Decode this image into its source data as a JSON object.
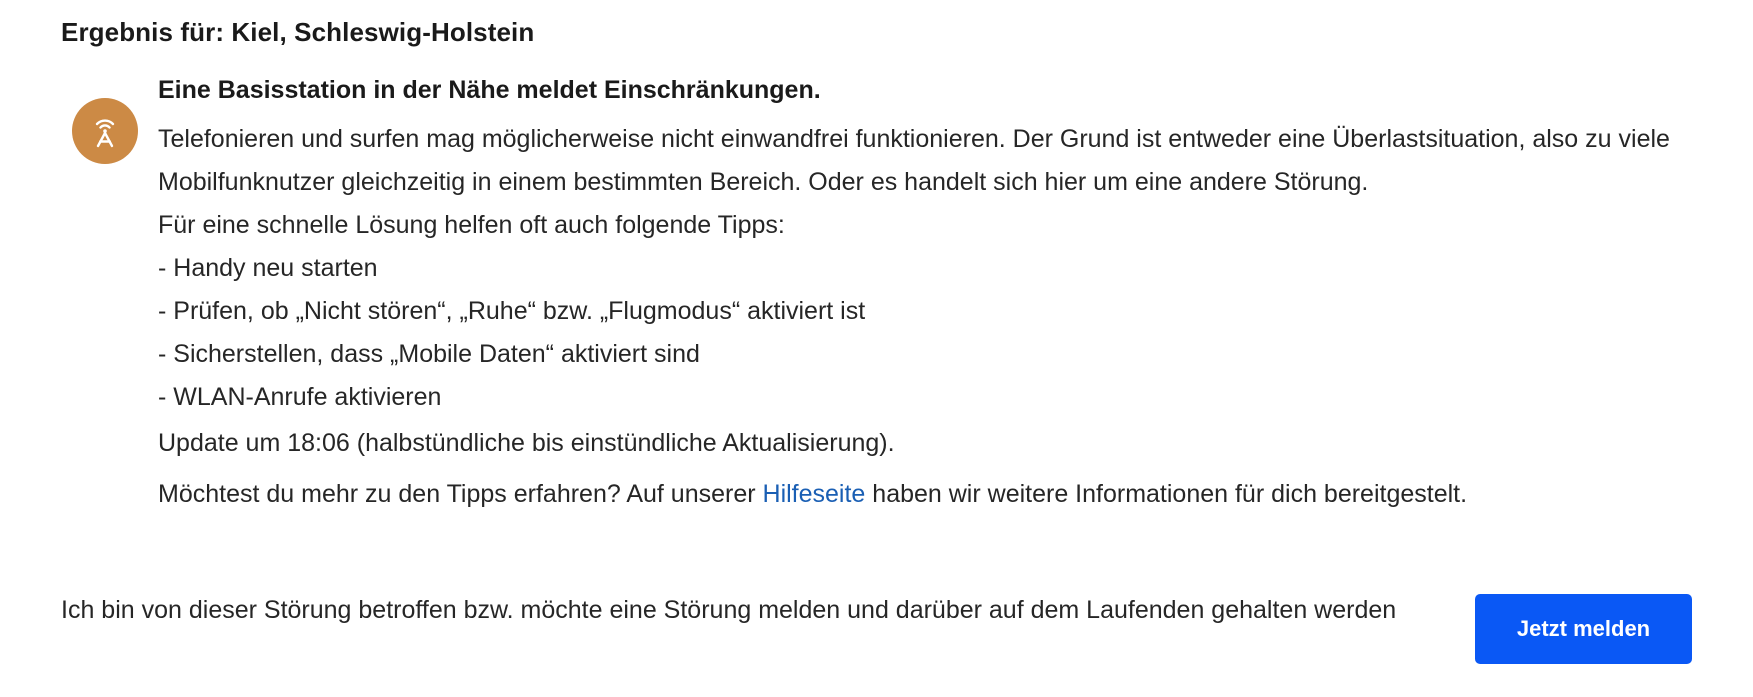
{
  "result": {
    "title": "Ergebnis für: Kiel, Schleswig-Holstein"
  },
  "status": {
    "icon": "cell-tower-icon",
    "icon_color": "#cc8a45",
    "headline": "Eine Basisstation in der Nähe meldet Einschränkungen.",
    "description": "Telefonieren und surfen mag möglicherweise nicht einwandfrei funktionieren. Der Grund ist entweder eine Überlastsituation, also zu viele Mobilfunknutzer gleichzeitig in einem bestimmten Bereich. Oder es handelt sich hier um eine andere Störung.",
    "tips_intro": "Für eine schnelle Lösung helfen oft auch folgende Tipps:",
    "tips": [
      "- Handy neu starten",
      "- Prüfen, ob „Nicht stören“, „Ruhe“ bzw. „Flugmodus“ aktiviert ist",
      "- Sicherstellen, dass „Mobile Daten“ aktiviert sind",
      "- WLAN-Anrufe aktivieren"
    ],
    "update": "Update um 18:06 (halbstündliche bis einstündliche Aktualisierung).",
    "help_prefix": "Möchtest du mehr zu den Tipps erfahren? Auf unserer ",
    "help_link": "Hilfeseite",
    "help_suffix": " haben wir weitere Informationen für dich bereitgestelt.",
    "link_color": "#1a5fb4"
  },
  "report": {
    "text": "Ich bin von dieser Störung betroffen bzw. möchte eine Störung melden und darüber auf dem Laufenden gehalten werden",
    "button_label": "Jetzt melden",
    "button_color": "#0a58f5"
  }
}
